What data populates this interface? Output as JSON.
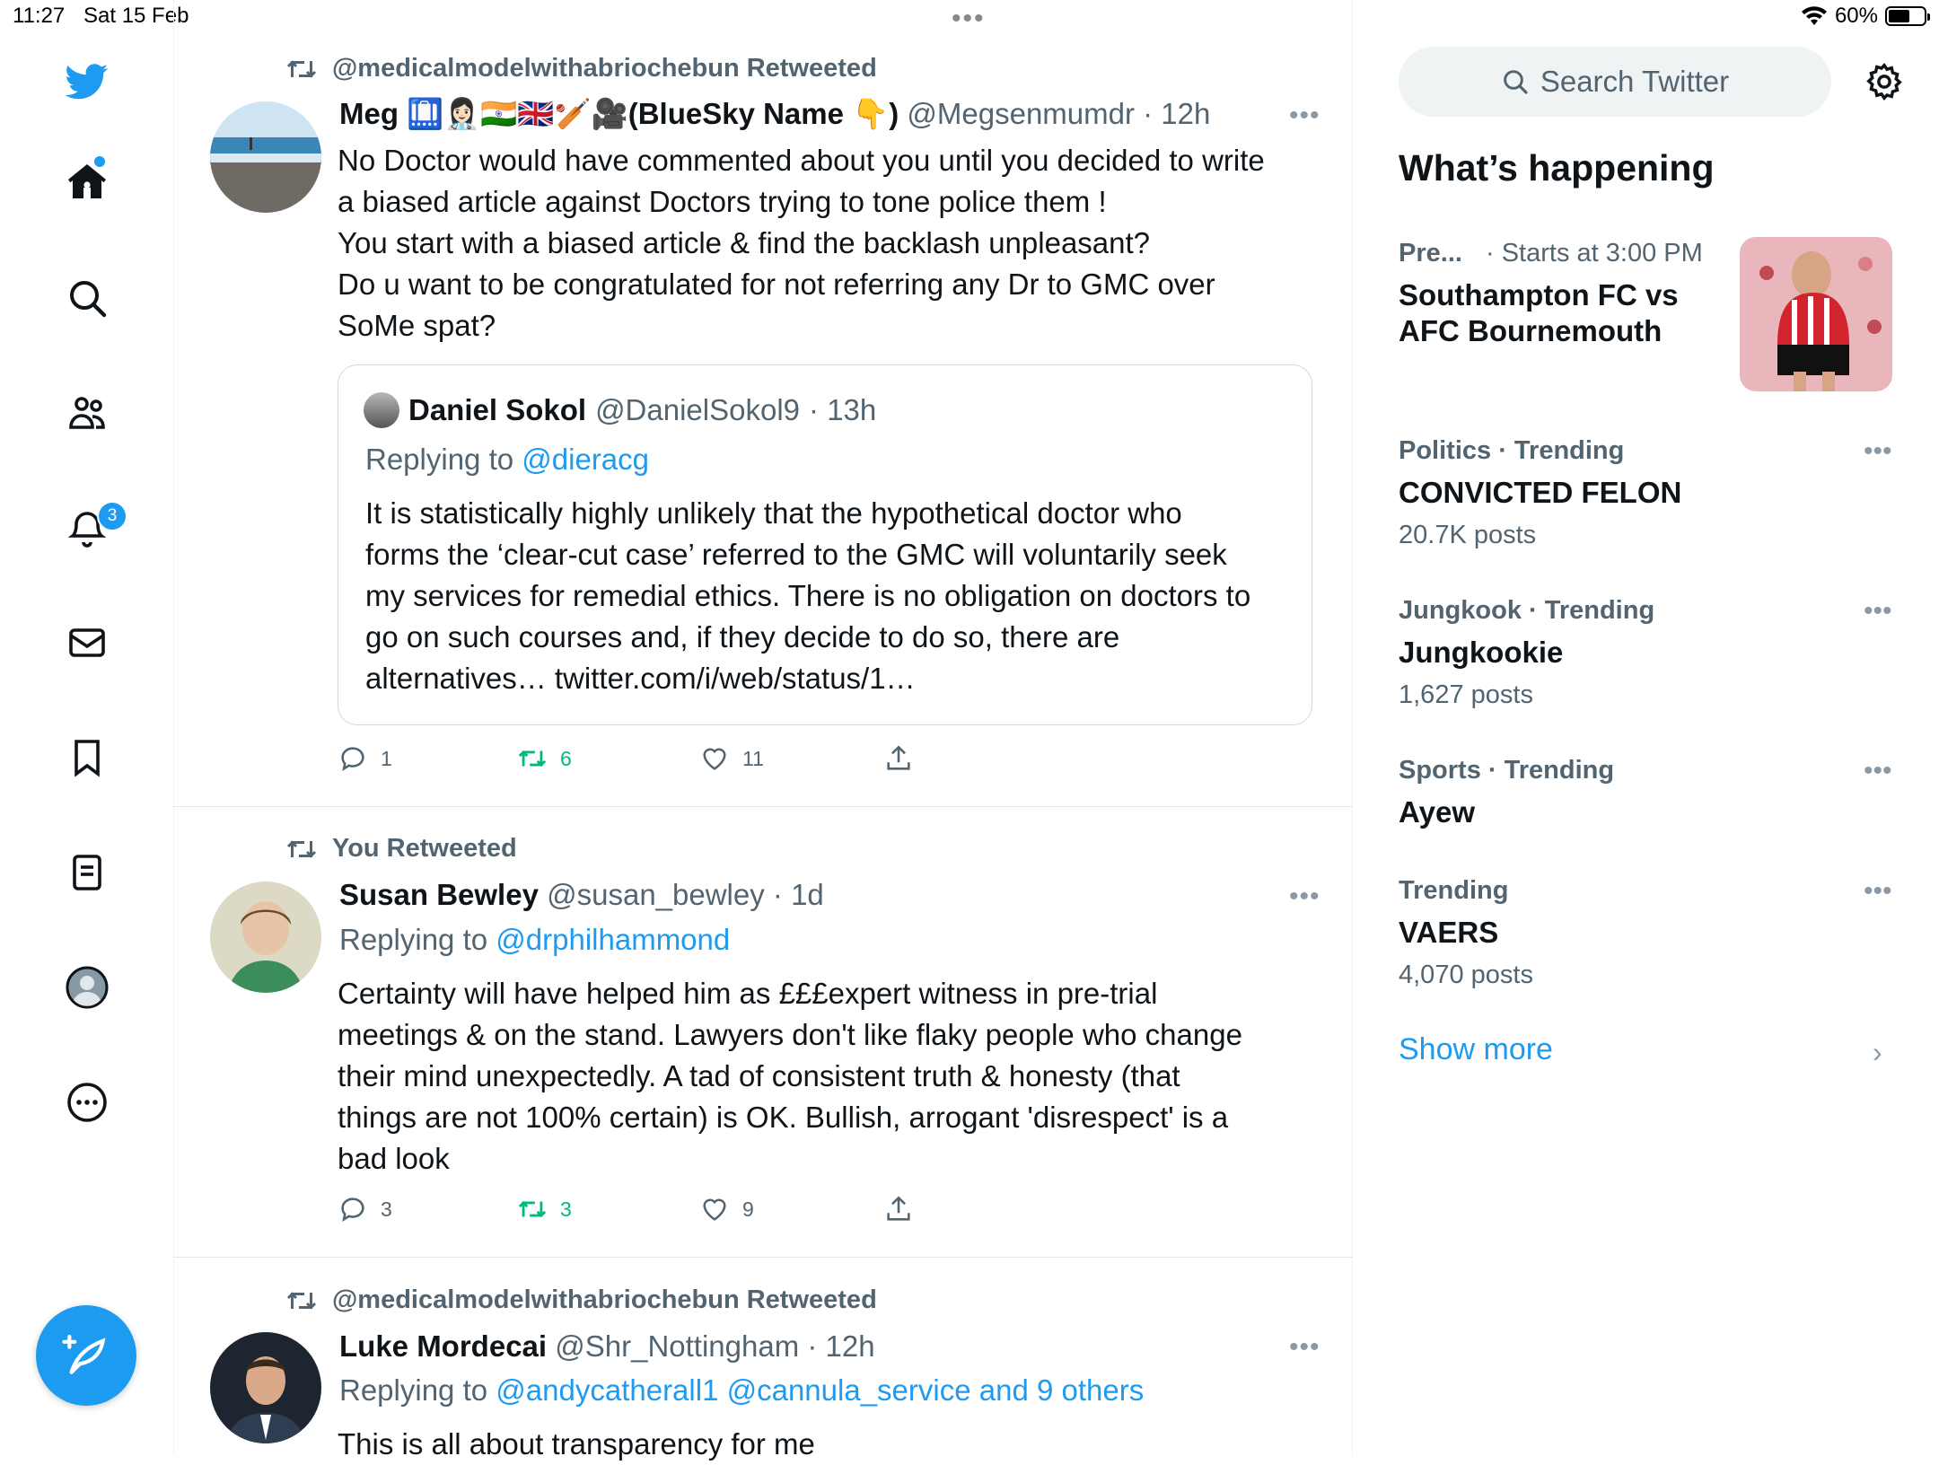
{
  "status_bar": {
    "time": "11:27",
    "date": "Sat 15 Feb",
    "battery": "60%",
    "battery_level": 0.6,
    "dots": "•••"
  },
  "nav": {
    "notifications_badge": "3"
  },
  "tweets": [
    {
      "retweet_label": "@medicalmodelwithabriochebun Retweeted",
      "name": "Meg 🛄👩🏻‍⚕️🇮🇳🇬🇧🏏🎥(BlueSky Name 👇)",
      "handle": "@Megsenmumdr",
      "time": "· 12h",
      "more": "•••",
      "lines": [
        "No Doctor would have commented about you until you decided to write",
        "a biased article against Doctors trying to tone police them !",
        "You start with a biased article & find the backlash unpleasant?",
        "Do u want to be congratulated for not referring any Dr to GMC over",
        "SoMe spat?"
      ],
      "quote": {
        "name": "Daniel Sokol",
        "handle": "@DanielSokol9",
        "time": "· 13h",
        "replying_prefix": "Replying to",
        "replying_to": "@dieracg",
        "lines": [
          "It is statistically highly unlikely that the hypothetical doctor who",
          "forms the ‘clear-cut case’ referred to the GMC will voluntarily seek",
          "my services for remedial ethics. There is no obligation on doctors to",
          "go on such courses and, if they decide to do so, there are",
          "alternatives… twitter.com/i/web/status/1…"
        ]
      },
      "replies": "1",
      "retweets": "6",
      "likes": "11"
    },
    {
      "retweet_label": "You Retweeted",
      "name": "Susan Bewley",
      "handle": "@susan_bewley",
      "time": "· 1d",
      "more": "•••",
      "replying_prefix": "Replying to",
      "replying_to": "@drphilhammond",
      "lines": [
        "Certainty will have helped him as £££expert witness in pre-trial",
        "meetings & on the stand. Lawyers don't like flaky people who change",
        "their mind unexpectedly. A tad of consistent truth & honesty (that",
        "things are not 100% certain) is OK. Bullish, arrogant 'disrespect' is a",
        "bad look"
      ],
      "replies": "3",
      "retweets": "3",
      "likes": "9"
    },
    {
      "retweet_label": "@medicalmodelwithabriochebun Retweeted",
      "name": "Luke Mordecai",
      "handle": "@Shr_Nottingham",
      "time": "· 12h",
      "more": "•••",
      "replying_prefix": "Replying to",
      "replying_to": "@andycatherall1 @cannula_service and 9 others",
      "lines": [
        "This is all about transparency for me"
      ]
    }
  ],
  "sidebar": {
    "search_placeholder": "Search Twitter",
    "title": "What’s happening",
    "event": {
      "category": "Pre...",
      "time": "· Starts at 3:00 PM",
      "title_line1": "Southampton FC vs",
      "title_line2": "AFC Bournemouth"
    },
    "trends": [
      {
        "meta": "Politics · Trending",
        "name": "CONVICTED FELON",
        "posts": "20.7K posts"
      },
      {
        "meta": "Jungkook · Trending",
        "name": "Jungkookie",
        "posts": "1,627 posts"
      },
      {
        "meta": "Sports · Trending",
        "name": "Ayew",
        "posts": ""
      },
      {
        "meta": "Trending",
        "name": "VAERS",
        "posts": "4,070 posts"
      }
    ],
    "trend_more": "•••",
    "show_more": "Show more",
    "chevron": "›"
  },
  "colors": {
    "accent": "#1d9bf0",
    "retweet_green": "#00ba7c",
    "muted": "#536471"
  }
}
